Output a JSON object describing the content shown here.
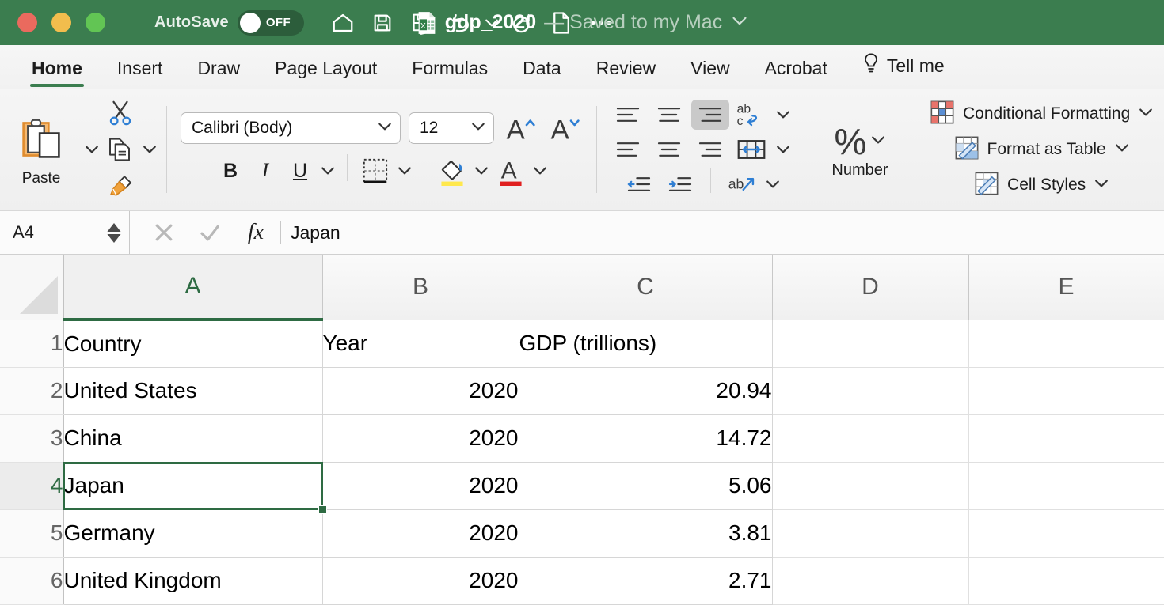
{
  "titlebar": {
    "autosave_label": "AutoSave",
    "autosave_state": "OFF",
    "doc_name": "gdp_2020",
    "doc_status": "— Saved to my Mac",
    "icons": [
      "home-icon",
      "save-icon",
      "save-as-icon",
      "undo-icon",
      "redo-icon",
      "new-document-icon",
      "more-options-icon"
    ],
    "accent_color": "#3b7d4f"
  },
  "tabs": [
    {
      "label": "Home",
      "active": true
    },
    {
      "label": "Insert",
      "active": false
    },
    {
      "label": "Draw",
      "active": false
    },
    {
      "label": "Page Layout",
      "active": false
    },
    {
      "label": "Formulas",
      "active": false
    },
    {
      "label": "Data",
      "active": false
    },
    {
      "label": "Review",
      "active": false
    },
    {
      "label": "View",
      "active": false
    },
    {
      "label": "Acrobat",
      "active": false
    },
    {
      "label": "Tell me",
      "active": false
    }
  ],
  "ribbon": {
    "clipboard": {
      "paste_label": "Paste",
      "cut_icon": "scissors-icon",
      "copy_icon": "copy-icon",
      "format_painter_icon": "format-painter-icon"
    },
    "font": {
      "family_value": "Calibri (Body)",
      "size_value": "12",
      "bold_label": "B",
      "italic_label": "I",
      "underline_label": "U",
      "grow_font_icon": "grow-font-icon",
      "shrink_font_icon": "shrink-font-icon",
      "borders_icon": "borders-icon",
      "fill_color_icon": "fill-color-icon",
      "fill_color": "#ffe84d",
      "font_color_icon": "font-color-icon",
      "font_color": "#e02020"
    },
    "alignment": {
      "wrap_text_icon": "wrap-text-icon",
      "merge_cells_icon": "merge-cells-icon",
      "orientation_icon": "orientation-icon",
      "selected_alignment": "align-top-right"
    },
    "number": {
      "label": "Number",
      "format_icon": "percent-icon"
    },
    "styles": [
      {
        "label": "Conditional Formatting",
        "icon": "conditional-formatting-icon"
      },
      {
        "label": "Format as Table",
        "icon": "format-as-table-icon"
      },
      {
        "label": "Cell Styles",
        "icon": "cell-styles-icon"
      }
    ]
  },
  "formula_bar": {
    "name_box": "A4",
    "cancel_icon": "cancel-icon",
    "confirm_icon": "confirm-icon",
    "function_icon": "fx-icon",
    "content": "Japan"
  },
  "sheet": {
    "columns": [
      "A",
      "B",
      "C",
      "D",
      "E"
    ],
    "active_column": "A",
    "rows": [
      "1",
      "2",
      "3",
      "4",
      "5",
      "6"
    ],
    "active_row": "4",
    "selected_cell": "A4",
    "data": [
      [
        "Country",
        "Year",
        "GDP (trillions)",
        "",
        ""
      ],
      [
        "United States",
        "2020",
        "20.94",
        "",
        ""
      ],
      [
        "China",
        "2020",
        "14.72",
        "",
        ""
      ],
      [
        "Japan",
        "2020",
        "5.06",
        "",
        ""
      ],
      [
        "Germany",
        "2020",
        "3.81",
        "",
        ""
      ],
      [
        "United Kingdom",
        "2020",
        "2.71",
        "",
        ""
      ]
    ],
    "numeric_columns": [
      1,
      2
    ],
    "selection_color": "#2e6b43"
  }
}
